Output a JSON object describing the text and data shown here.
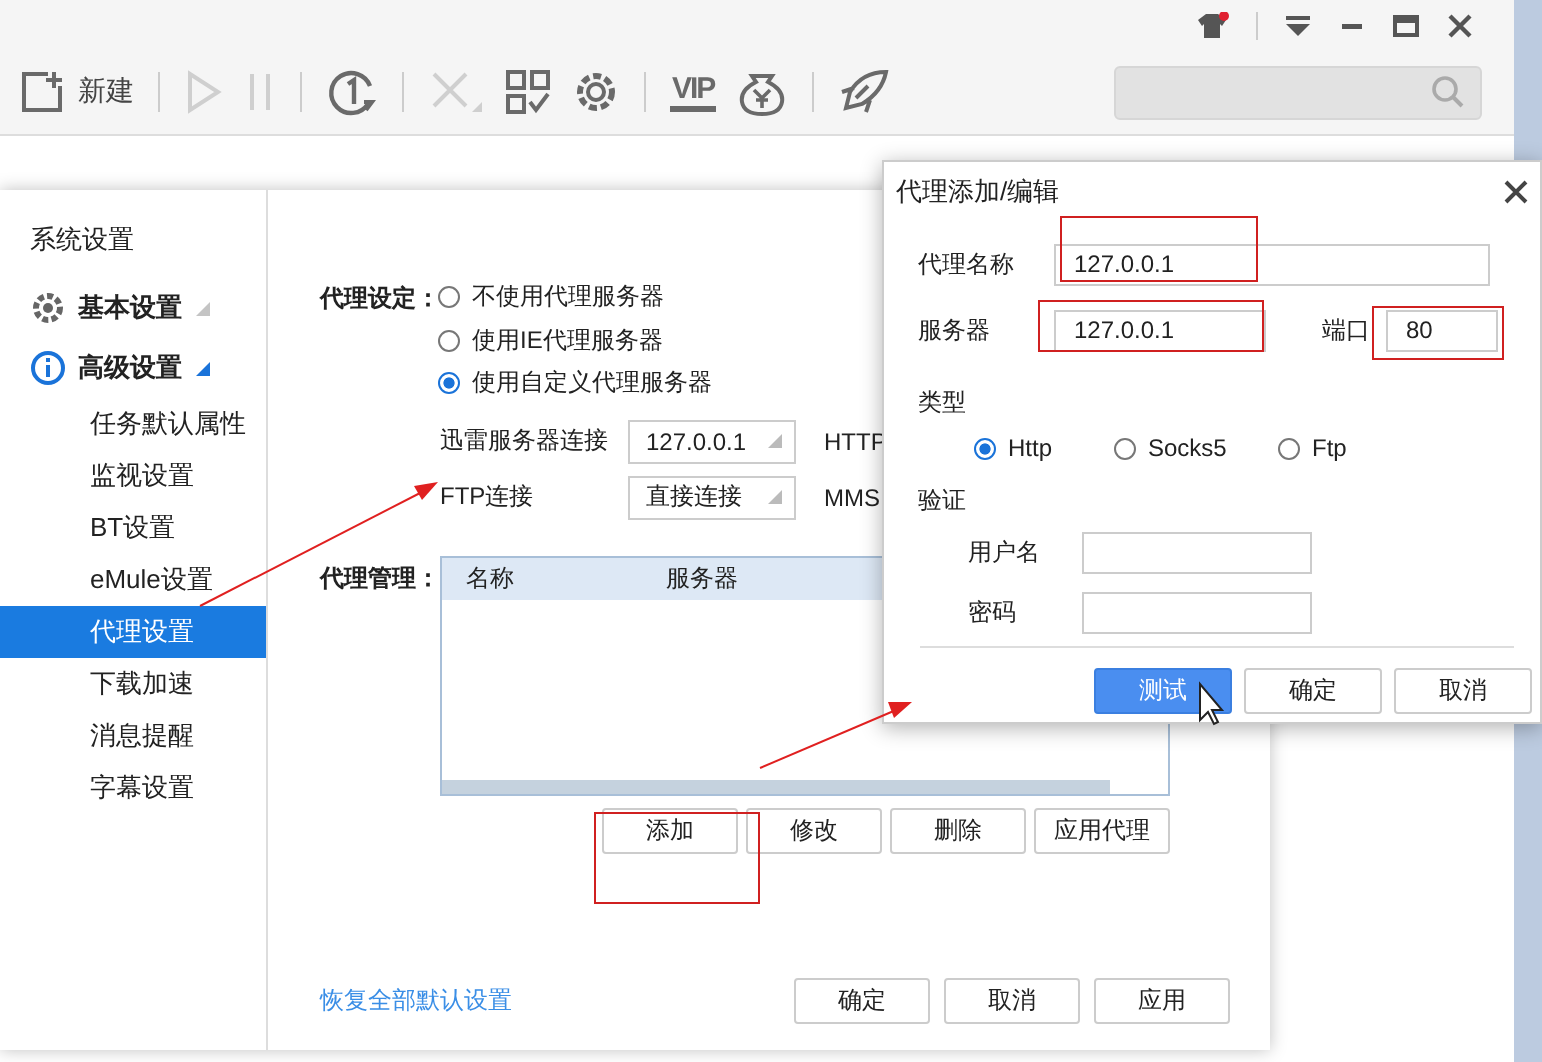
{
  "window": {
    "notification": true
  },
  "toolbar": [
    {
      "kind": "new",
      "label": "新建",
      "disabled": false
    },
    {
      "kind": "separator"
    },
    {
      "kind": "play",
      "disabled": true
    },
    {
      "kind": "pause",
      "disabled": true
    },
    {
      "kind": "separator"
    },
    {
      "kind": "once",
      "disabled": false
    },
    {
      "kind": "separator"
    },
    {
      "kind": "delete",
      "disabled": true
    },
    {
      "kind": "grid",
      "disabled": false
    },
    {
      "kind": "gear",
      "disabled": false
    },
    {
      "kind": "separator"
    },
    {
      "kind": "vip",
      "label": "VIP",
      "disabled": false
    },
    {
      "kind": "coin",
      "disabled": false
    },
    {
      "kind": "separator"
    },
    {
      "kind": "rocket",
      "disabled": false
    }
  ],
  "sidebar": {
    "title": "系统设置",
    "groups": [
      {
        "label": "基本设置",
        "kind": "gear",
        "expanded": false
      },
      {
        "label": "高级设置",
        "kind": "info",
        "expanded": true,
        "children": [
          {
            "label": "任务默认属性",
            "selected": false
          },
          {
            "label": "监视设置",
            "selected": false
          },
          {
            "label": "BT设置",
            "selected": false
          },
          {
            "label": "eMule设置",
            "selected": false
          },
          {
            "label": "代理设置",
            "selected": true
          },
          {
            "label": "下载加速",
            "selected": false
          },
          {
            "label": "消息提醒",
            "selected": false
          },
          {
            "label": "字幕设置",
            "selected": false
          }
        ]
      }
    ]
  },
  "proxy_setting": {
    "label": "代理设定：",
    "options": [
      {
        "label": "不使用代理服务器",
        "selected": false
      },
      {
        "label": "使用IE代理服务器",
        "selected": false
      },
      {
        "label": "使用自定义代理服务器",
        "selected": true
      }
    ],
    "connections": [
      {
        "label": "迅雷服务器连接",
        "value": "127.0.0.1",
        "protocol": "HTTP"
      },
      {
        "label": "FTP连接",
        "value": "直接连接",
        "protocol": "MMS"
      }
    ]
  },
  "proxy_manager": {
    "label": "代理管理：",
    "columns": [
      "名称",
      "服务器"
    ],
    "buttons": [
      "添加",
      "修改",
      "删除",
      "应用代理"
    ]
  },
  "restore_link": "恢复全部默认设置",
  "buttons": [
    "确定",
    "取消",
    "应用"
  ],
  "dialog": {
    "title": "代理添加/编辑",
    "name_label": "代理名称",
    "name": "127.0.0.1",
    "server_label": "服务器",
    "server": "127.0.0.1",
    "port_label": "端口",
    "port": "80",
    "type_label": "类型",
    "types": [
      {
        "label": "Http",
        "selected": true
      },
      {
        "label": "Socks5",
        "selected": false
      },
      {
        "label": "Ftp",
        "selected": false
      }
    ],
    "auth_label": "验证",
    "username_label": "用户名",
    "password_label": "密码",
    "buttons": [
      {
        "label": "测试",
        "primary": true
      },
      {
        "label": "确定",
        "primary": false
      },
      {
        "label": "取消",
        "primary": false
      }
    ]
  }
}
